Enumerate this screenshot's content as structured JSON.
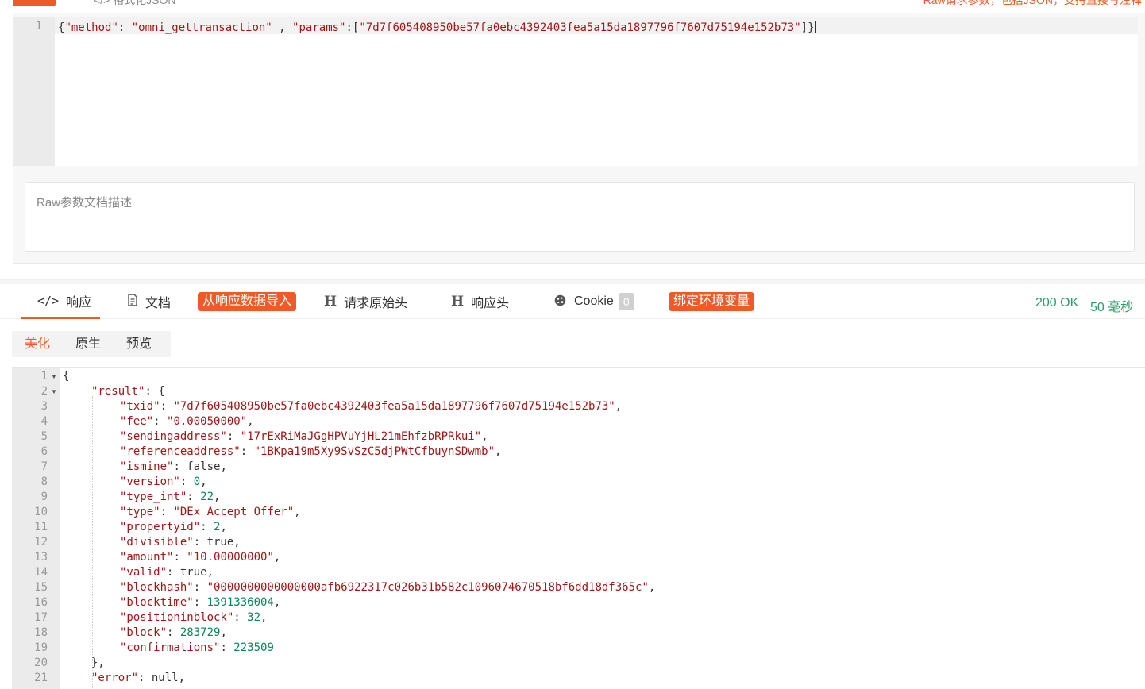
{
  "top": {
    "tag_label": "",
    "format_label": "</> 格式化JSON",
    "hint": "Raw请求参数，包括JSON，支持直接写注释"
  },
  "request": {
    "line_number": "1",
    "code_parts": {
      "open": "{",
      "k1": "\"method\"",
      "c1": ": ",
      "v1": "\"omni_gettransaction\"",
      "c2": " , ",
      "k2": "\"params\"",
      "c3": ":[",
      "v2": "\"7d7f605408950be57fa0ebc4392403fea5a15da1897796f7607d75194e152b73\"",
      "close": "]}"
    },
    "description_placeholder": "Raw参数文档描述"
  },
  "tabs": {
    "response": "响应",
    "docs": "文档",
    "import_from_response": "从响应数据导入",
    "request_headers": "请求原始头",
    "response_headers": "响应头",
    "cookie": "Cookie",
    "cookie_count": "0",
    "bind_env_vars": "绑定环境变量"
  },
  "status": {
    "code": "200 OK",
    "time": "50 毫秒"
  },
  "view_modes": [
    "美化",
    "原生",
    "预览"
  ],
  "response_lines": [
    {
      "n": "1",
      "fold": true,
      "indent": 0,
      "key": "",
      "value": "{",
      "vtype": "p",
      "tail": ""
    },
    {
      "n": "2",
      "fold": true,
      "indent": 1,
      "key": "\"result\"",
      "value": "{",
      "vtype": "p",
      "tail": ""
    },
    {
      "n": "3",
      "indent": 2,
      "key": "\"txid\"",
      "value": "\"7d7f605408950be57fa0ebc4392403fea5a15da1897796f7607d75194e152b73\"",
      "vtype": "s",
      "tail": ","
    },
    {
      "n": "4",
      "indent": 2,
      "key": "\"fee\"",
      "value": "\"0.00050000\"",
      "vtype": "s",
      "tail": ","
    },
    {
      "n": "5",
      "indent": 2,
      "key": "\"sendingaddress\"",
      "value": "\"17rExRiMaJGgHPVuYjHL21mEhfzbRPRkui\"",
      "vtype": "s",
      "tail": ","
    },
    {
      "n": "6",
      "indent": 2,
      "key": "\"referenceaddress\"",
      "value": "\"1BKpa19m5Xy9SvSzC5djPWtCfbuynSDwmb\"",
      "vtype": "s",
      "tail": ","
    },
    {
      "n": "7",
      "indent": 2,
      "key": "\"ismine\"",
      "value": "false",
      "vtype": "p",
      "tail": ","
    },
    {
      "n": "8",
      "indent": 2,
      "key": "\"version\"",
      "value": "0",
      "vtype": "n",
      "tail": ","
    },
    {
      "n": "9",
      "indent": 2,
      "key": "\"type_int\"",
      "value": "22",
      "vtype": "n",
      "tail": ","
    },
    {
      "n": "10",
      "indent": 2,
      "key": "\"type\"",
      "value": "\"DEx Accept Offer\"",
      "vtype": "s",
      "tail": ","
    },
    {
      "n": "11",
      "indent": 2,
      "key": "\"propertyid\"",
      "value": "2",
      "vtype": "n",
      "tail": ","
    },
    {
      "n": "12",
      "indent": 2,
      "key": "\"divisible\"",
      "value": "true",
      "vtype": "p",
      "tail": ","
    },
    {
      "n": "13",
      "indent": 2,
      "key": "\"amount\"",
      "value": "\"10.00000000\"",
      "vtype": "s",
      "tail": ","
    },
    {
      "n": "14",
      "indent": 2,
      "key": "\"valid\"",
      "value": "true",
      "vtype": "p",
      "tail": ","
    },
    {
      "n": "15",
      "indent": 2,
      "key": "\"blockhash\"",
      "value": "\"0000000000000000afb6922317c026b31b582c1096074670518bf6dd18df365c\"",
      "vtype": "s",
      "tail": ","
    },
    {
      "n": "16",
      "indent": 2,
      "key": "\"blocktime\"",
      "value": "1391336004",
      "vtype": "n",
      "tail": ","
    },
    {
      "n": "17",
      "indent": 2,
      "key": "\"positioninblock\"",
      "value": "32",
      "vtype": "n",
      "tail": ","
    },
    {
      "n": "18",
      "indent": 2,
      "key": "\"block\"",
      "value": "283729",
      "vtype": "n",
      "tail": ","
    },
    {
      "n": "19",
      "indent": 2,
      "key": "\"confirmations\"",
      "value": "223509",
      "vtype": "n",
      "tail": ""
    },
    {
      "n": "20",
      "indent": 1,
      "key": "",
      "value": "},",
      "vtype": "p",
      "tail": ""
    },
    {
      "n": "21",
      "indent": 1,
      "key": "\"error\"",
      "value": "null",
      "vtype": "p",
      "tail": ","
    }
  ]
}
